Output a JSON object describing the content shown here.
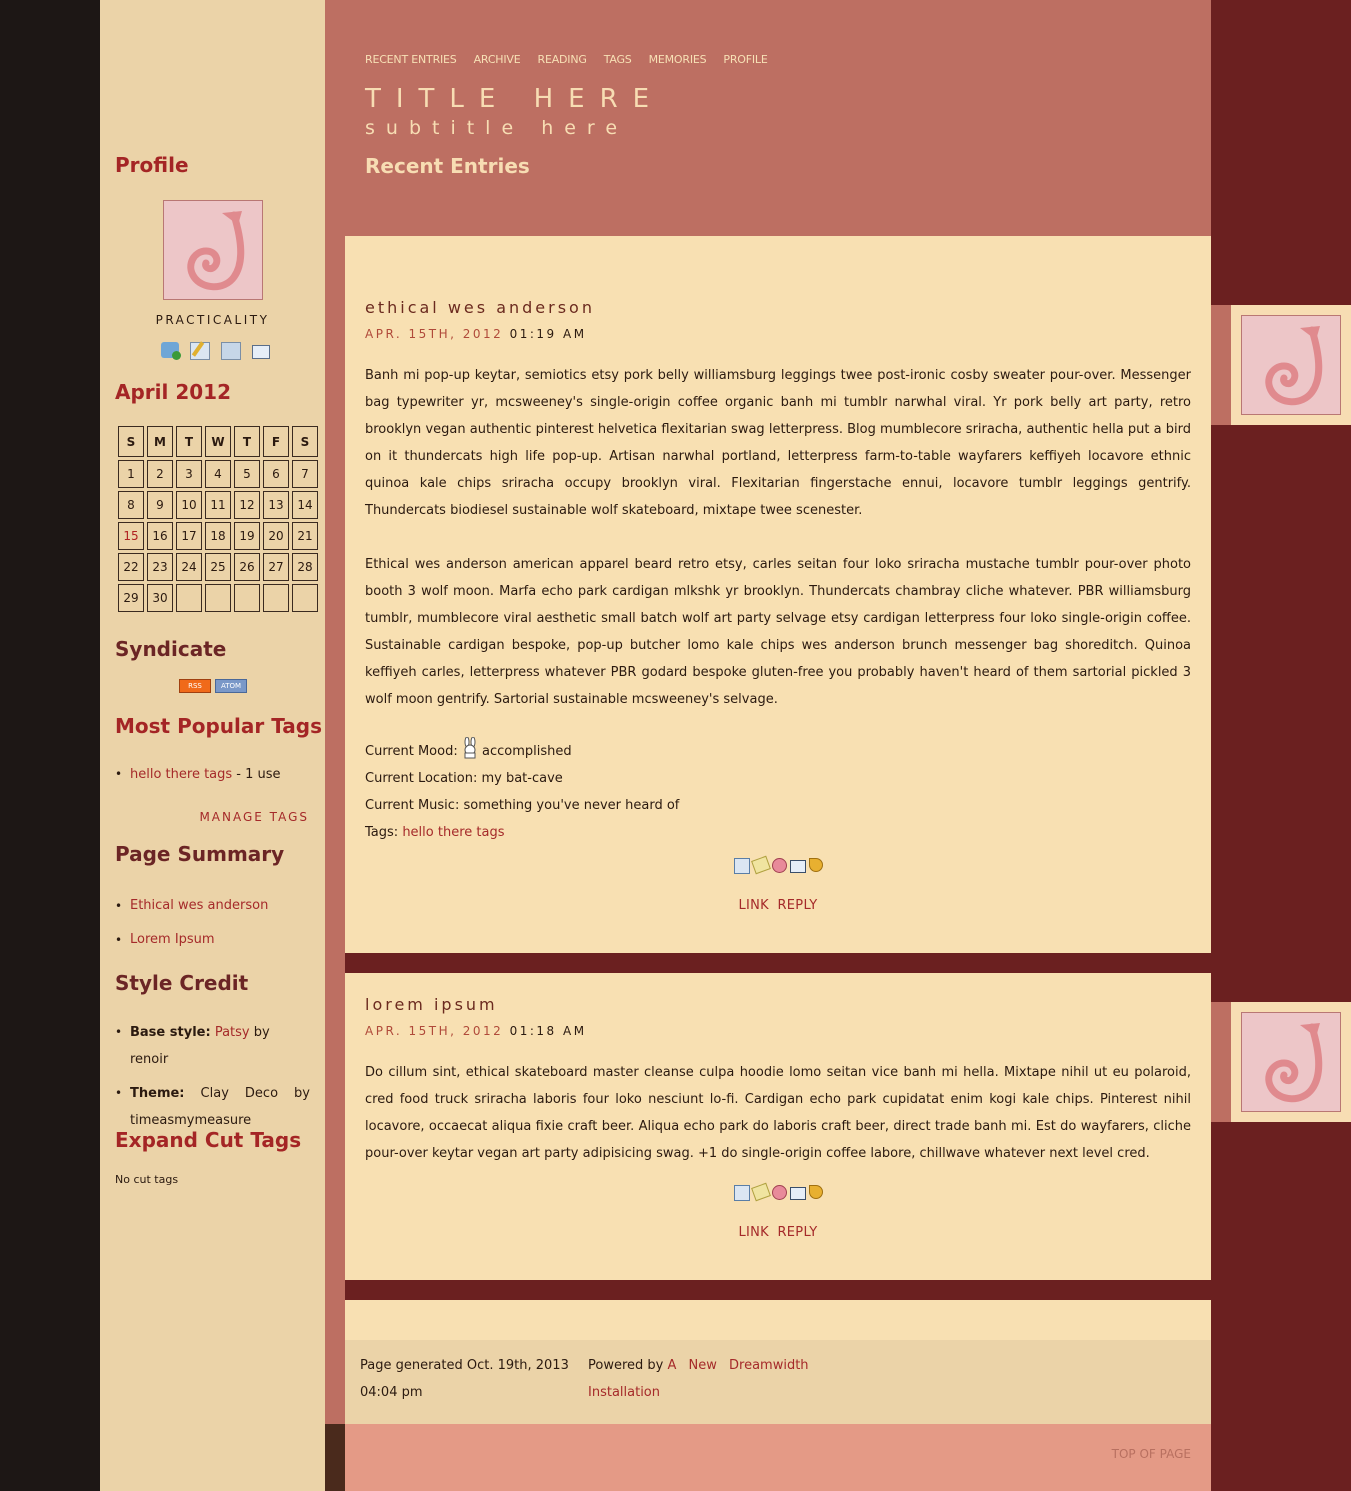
{
  "nav": [
    "RECENT ENTRIES",
    "ARCHIVE",
    "READING",
    "TAGS",
    "MEMORIES",
    "PROFILE"
  ],
  "header": {
    "title": "TITLE HERE",
    "subtitle": "subtitle here",
    "page_heading": "Recent Entries"
  },
  "sidebar": {
    "profile_heading": "Profile",
    "username": "PRACTICALITY",
    "profile_icons": [
      "add-friend-icon",
      "post-entry-icon",
      "message-icon",
      "email-icon"
    ],
    "calendar": {
      "heading": "April 2012",
      "days": [
        "S",
        "M",
        "T",
        "W",
        "T",
        "F",
        "S"
      ],
      "weeks": [
        [
          "1",
          "2",
          "3",
          "4",
          "5",
          "6",
          "7"
        ],
        [
          "8",
          "9",
          "10",
          "11",
          "12",
          "13",
          "14"
        ],
        [
          "15",
          "16",
          "17",
          "18",
          "19",
          "20",
          "21"
        ],
        [
          "22",
          "23",
          "24",
          "25",
          "26",
          "27",
          "28"
        ],
        [
          "29",
          "30",
          "",
          "",
          "",
          "",
          ""
        ]
      ],
      "highlight": "15"
    },
    "syndicate_heading": "Syndicate",
    "syndicate": [
      "RSS",
      "ATOM"
    ],
    "tags_heading": "Most Popular Tags",
    "tag_link": "hello there tags",
    "tag_count": " - 1 use",
    "manage_tags": "MANAGE TAGS",
    "summary_heading": "Page Summary",
    "summary": [
      "Ethical wes anderson",
      "Lorem Ipsum"
    ],
    "credit_heading": "Style Credit",
    "credit_base_label": "Base style:",
    "credit_base_link": "Patsy",
    "credit_base_by": " by renoir",
    "credit_theme_label": "Theme:",
    "credit_theme_text": " Clay Deco by timeasmymeasure",
    "cut_heading": "Expand Cut Tags",
    "cut_text": "No cut tags"
  },
  "entries": [
    {
      "title": "ethical wes anderson",
      "date": "APR. 15TH, 2012",
      "time": "01:19 AM",
      "p1": "Banh mi pop-up keytar, semiotics etsy pork belly williamsburg leggings twee post-ironic cosby sweater pour-over. Messenger bag typewriter yr, mcsweeney's single-origin coffee organic banh mi tumblr narwhal viral. Yr pork belly art party, retro brooklyn vegan authentic pinterest helvetica flexitarian swag letterpress. Blog mumblecore sriracha, authentic hella put a bird on it thundercats high life pop-up. Artisan narwhal portland, letterpress farm-to-table wayfarers keffiyeh locavore ethnic quinoa kale chips sriracha occupy brooklyn viral. Flexitarian fingerstache ennui, locavore tumblr leggings gentrify. Thundercats biodiesel sustainable wolf skateboard, mixtape twee scenester.",
      "p2": "Ethical wes anderson american apparel beard retro etsy, carles seitan four loko sriracha mustache tumblr pour-over photo booth 3 wolf moon. Marfa echo park cardigan mlkshk yr brooklyn. Thundercats chambray cliche whatever. PBR williamsburg tumblr, mumblecore viral aesthetic small batch wolf art party selvage etsy cardigan letterpress four loko single-origin coffee. Sustainable cardigan bespoke, pop-up butcher lomo kale chips wes anderson brunch messenger bag shoreditch. Quinoa keffiyeh carles, letterpress whatever PBR godard bespoke gluten-free you probably haven't heard of them sartorial pickled 3 wolf moon gentrify. Sartorial sustainable mcsweeney's selvage.",
      "mood_label": "Current Mood:",
      "mood": "accomplished",
      "location_label": "Current Location:",
      "location": "my bat-cave",
      "music_label": "Current Music:",
      "music": "something you've never heard of",
      "tags_label": "Tags:",
      "tags": "hello there tags",
      "link": "LINK",
      "reply": "REPLY"
    },
    {
      "title": "lorem ipsum",
      "date": "APR. 15TH, 2012",
      "time": "01:18 AM",
      "p1": "Do cillum sint, ethical skateboard master cleanse culpa hoodie lomo seitan vice banh mi hella. Mixtape nihil ut eu polaroid, cred food truck sriracha laboris four loko nesciunt lo-fi. Cardigan echo park cupidatat enim kogi kale chips. Pinterest nihil locavore, occaecat aliqua fixie craft beer. Aliqua echo park do laboris craft beer, direct trade banh mi. Est do wayfarers, cliche pour-over keytar vegan art party adipisicing swag. +1 do single-origin coffee labore, chillwave whatever next level cred.",
      "link": "LINK",
      "reply": "REPLY"
    }
  ],
  "entry_action_icons": [
    "edit-entry-icon",
    "edit-tags-icon",
    "memories-icon",
    "email-entry-icon",
    "track-icon"
  ],
  "footer": {
    "generated": "Page generated Oct. 19th, 2013 04:04 pm",
    "powered": "Powered by",
    "powered_link": "A New Dreamwidth Installation",
    "top": "TOP OF PAGE"
  },
  "colors": {
    "dark_col": "#1d1715",
    "sidebar": "#ebd3a8",
    "header": "#bd6f62",
    "entry_bg": "#f8e0b2",
    "right_col": "#6b2020",
    "link": "#a52a2a",
    "footer_bottom": "#e49a86"
  }
}
